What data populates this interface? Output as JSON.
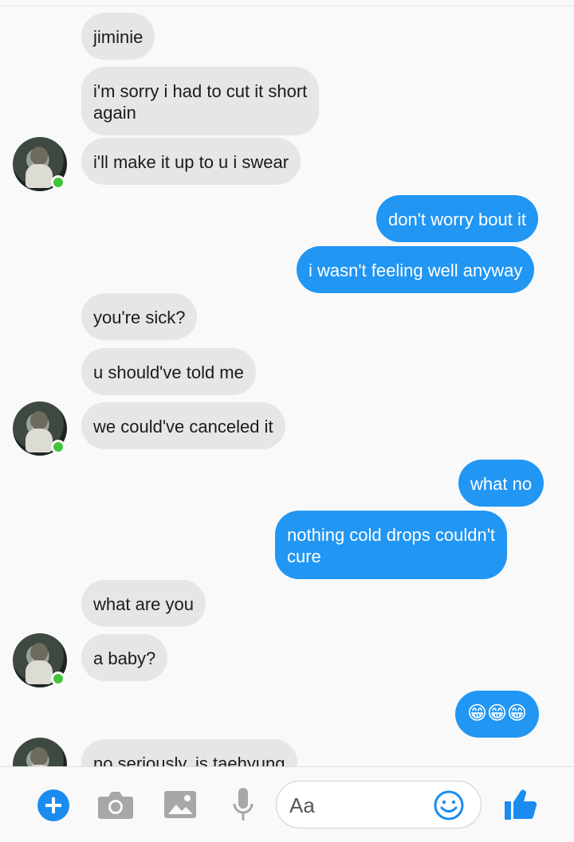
{
  "conversation": {
    "messages": [
      {
        "direction": "incoming",
        "lines": [
          "jiminie"
        ]
      },
      {
        "direction": "incoming",
        "lines": [
          "i'm sorry i had to cut it short",
          "again"
        ]
      },
      {
        "direction": "incoming",
        "lines": [
          "i'll make it up to u i swear"
        ]
      },
      {
        "direction": "outgoing",
        "lines": [
          "don't worry bout it"
        ]
      },
      {
        "direction": "outgoing",
        "lines": [
          "i wasn't feeling well anyway"
        ]
      },
      {
        "direction": "incoming",
        "lines": [
          "you're sick?"
        ]
      },
      {
        "direction": "incoming",
        "lines": [
          "u should've told me"
        ]
      },
      {
        "direction": "incoming",
        "lines": [
          "we could've canceled it"
        ]
      },
      {
        "direction": "outgoing",
        "lines": [
          "what no"
        ]
      },
      {
        "direction": "outgoing",
        "lines": [
          "nothing cold drops couldn't",
          "cure"
        ]
      },
      {
        "direction": "incoming",
        "lines": [
          "what are you"
        ]
      },
      {
        "direction": "incoming",
        "lines": [
          "a baby?"
        ]
      },
      {
        "direction": "outgoing",
        "lines": [
          "😁😁😁"
        ]
      },
      {
        "direction": "incoming",
        "lines": [
          "no seriously, is taehyung"
        ]
      }
    ]
  },
  "composer": {
    "placeholder": "Aa",
    "icons": [
      "plus-icon",
      "camera-icon",
      "image-icon",
      "microphone-icon",
      "smiley-icon",
      "thumbs-up-icon"
    ]
  },
  "colors": {
    "outgoing_bubble": "#2196f3",
    "incoming_bubble": "#e6e6e6",
    "accent_blue": "#1a8cf0",
    "online_dot": "#42c43a",
    "icon_grey": "#a7a7a7"
  }
}
